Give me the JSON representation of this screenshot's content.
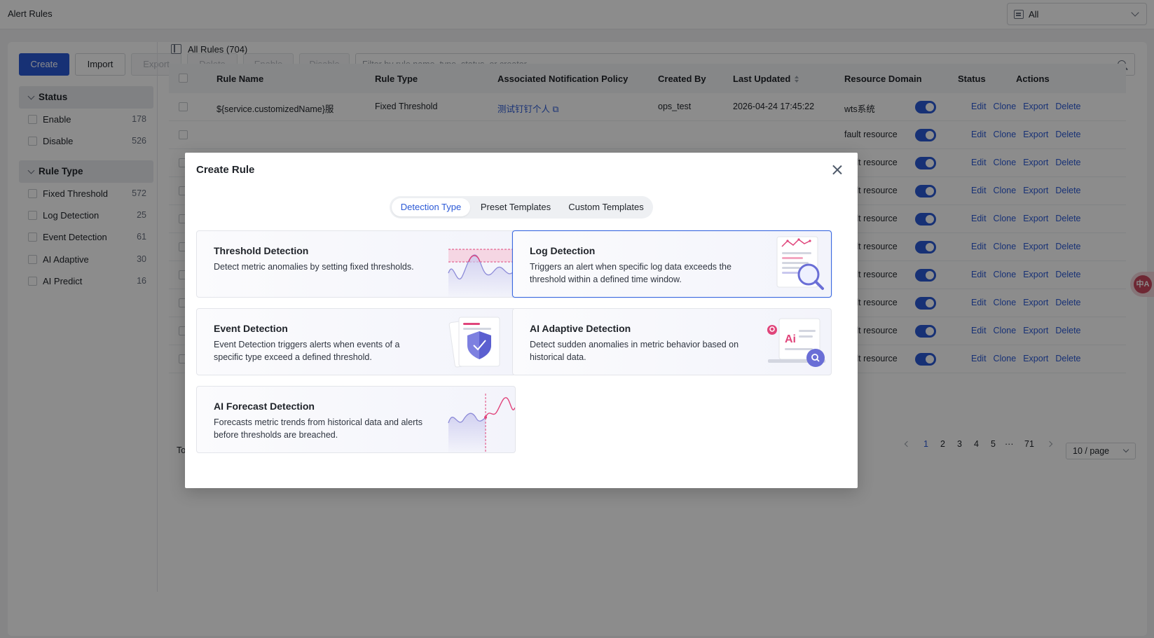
{
  "page": {
    "title": "Alert Rules"
  },
  "domain_select": {
    "value": "All"
  },
  "toolbar": {
    "create": "Create",
    "import": "Import",
    "export": "Export",
    "delete": "Delete",
    "enable": "Enable",
    "disable": "Disable",
    "search_placeholder": "Filter by rule name, type, status, or creator"
  },
  "filters": {
    "status": {
      "label": "Status",
      "items": [
        {
          "label": "Enable",
          "count": "178"
        },
        {
          "label": "Disable",
          "count": "526"
        }
      ]
    },
    "rule_type": {
      "label": "Rule Type",
      "items": [
        {
          "label": "Fixed Threshold",
          "count": "572"
        },
        {
          "label": "Log Detection",
          "count": "25"
        },
        {
          "label": "Event Detection",
          "count": "61"
        },
        {
          "label": "AI Adaptive",
          "count": "30"
        },
        {
          "label": "AI Predict",
          "count": "16"
        }
      ]
    }
  },
  "table": {
    "all_rules_label": "All Rules (704)",
    "columns": [
      "Rule Name",
      "Rule Type",
      "Associated Notification Policy",
      "Created By",
      "Last Updated",
      "Resource Domain",
      "Status",
      "Actions"
    ],
    "first_row": {
      "rule_name": "${service.customizedName}服",
      "rule_type": "Fixed Threshold",
      "policy": "测试钉钉个人 ⧉",
      "created_by": "ops_test",
      "last_updated": "2026-04-24 17:45:22",
      "resource_domain": "wts系统"
    },
    "row_domain_partial": "fault resource",
    "actions": [
      "Edit",
      "Clone",
      "Export",
      "Delete"
    ]
  },
  "pagination": {
    "total_partial": "To",
    "pages": [
      "1",
      "2",
      "3",
      "4",
      "5",
      "···",
      "71"
    ],
    "current": "1",
    "page_size": "10 / page"
  },
  "floating_translate": {
    "glyph": "中A"
  },
  "modal": {
    "title": "Create Rule",
    "tabs": [
      "Detection Type",
      "Preset Templates",
      "Custom Templates"
    ],
    "active_tab": "Detection Type",
    "cards": [
      {
        "title": "Threshold Detection",
        "desc": "Detect metric anomalies by setting fixed thresholds.",
        "icon": "threshold-chart-icon"
      },
      {
        "title": "Log Detection",
        "desc": "Triggers an alert when specific log data exceeds the threshold within a defined time window.",
        "icon": "log-search-icon",
        "selected": true
      },
      {
        "title": "Event Detection",
        "desc": "Event Detection triggers alerts when events of a specific type exceed a defined threshold.",
        "icon": "shield-icon"
      },
      {
        "title": "AI Adaptive Detection",
        "desc": "Detect sudden anomalies in metric behavior based on historical data.",
        "icon": "ai-laptop-icon"
      },
      {
        "title": "AI Forecast Detection",
        "desc": "Forecasts metric trends from historical data and alerts before thresholds are breached.",
        "icon": "forecast-chart-icon"
      }
    ]
  },
  "colors": {
    "accent": "#2b59d6",
    "pink": "#e0457b",
    "purple_light": "#c9c8ee"
  }
}
